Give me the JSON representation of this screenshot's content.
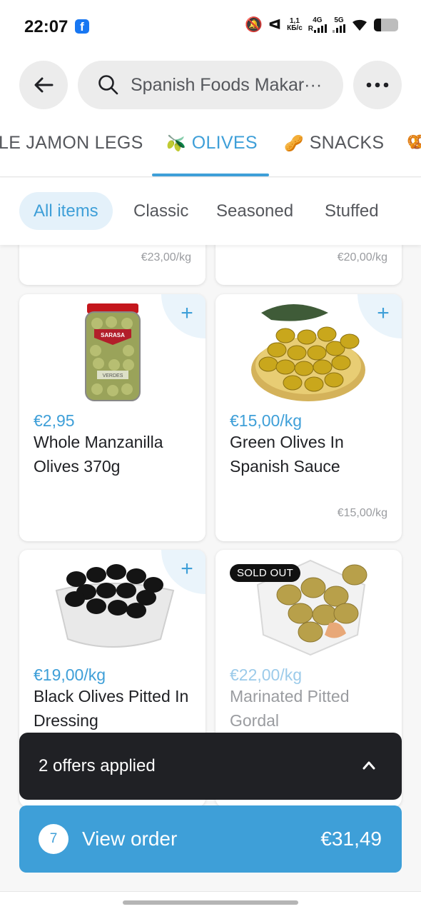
{
  "status_bar": {
    "time": "22:07",
    "data_speed_value": "1,1",
    "data_speed_unit": "КБ/с",
    "net1": "4G",
    "net1_sub": "R",
    "net2": "5G",
    "battery_level": 0.3
  },
  "header": {
    "search_text": "Spanish Foods Makar···"
  },
  "category_tabs": [
    {
      "label": "LE JAMON LEGS",
      "emoji": ""
    },
    {
      "label": "OLIVES",
      "emoji": "🫒"
    },
    {
      "label": "SNACKS",
      "emoji": "🥜"
    }
  ],
  "filter_chips": [
    "All items",
    "Classic",
    "Seasoned",
    "Stuffed"
  ],
  "partial_row": [
    {
      "unit_price": "€23,00/kg"
    },
    {
      "unit_price": "€20,00/kg"
    }
  ],
  "products": [
    {
      "price": "€2,95",
      "title": "Whole Manzanilla Olives 370g",
      "unit_price": "",
      "sold_out": false,
      "jar_label": "SARASA",
      "jar_label2": "VERDES"
    },
    {
      "price": "€15,00/kg",
      "title": "Green Olives In Spanish Sauce",
      "unit_price": "€15,00/kg",
      "sold_out": false
    },
    {
      "price": "€19,00/kg",
      "title": "Black Olives Pitted In Dressing",
      "unit_price": "",
      "sold_out": false
    },
    {
      "price": "€22,00/kg",
      "title": "Marinated Pitted Gordal",
      "unit_price": "",
      "sold_out": true,
      "badge": "SOLD OUT"
    }
  ],
  "add_symbol": "+",
  "offers": {
    "label": "2 offers applied"
  },
  "order": {
    "count": "7",
    "label": "View order",
    "total": "€31,49"
  },
  "colors": {
    "accent": "#3e9fd8",
    "dark": "#202125"
  }
}
